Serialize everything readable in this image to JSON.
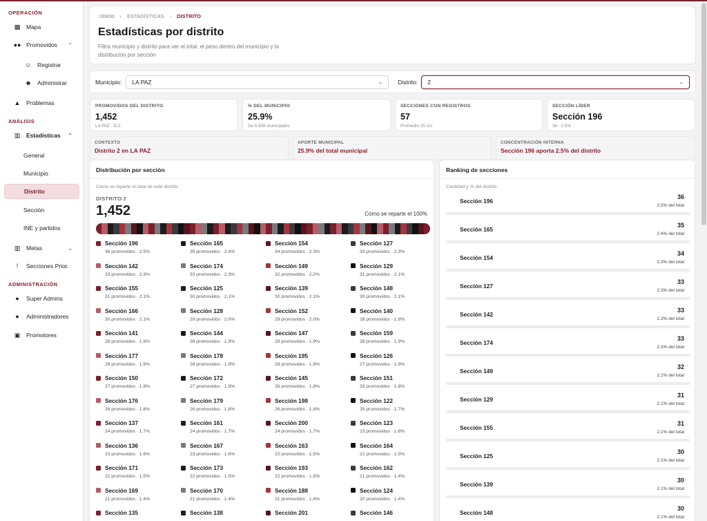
{
  "sidebar": {
    "sections": [
      {
        "title": "OPERACIÓN"
      },
      {
        "title": "ANÁLISIS"
      },
      {
        "title": "ADMINISTRACIÓN"
      }
    ],
    "items": {
      "mapa": {
        "label": "Mapa",
        "icon": "map-icon"
      },
      "promovidos": {
        "label": "Promovidos",
        "icon": "users-icon"
      },
      "registrar": {
        "label": "Registrar",
        "icon": "user-add-icon"
      },
      "administrar": {
        "label": "Administrar",
        "icon": "user-manage-icon"
      },
      "problemas": {
        "label": "Problemas",
        "icon": "warning-icon"
      },
      "estadisticas": {
        "label": "Estadísticas",
        "icon": "bar-chart-icon"
      },
      "general": {
        "label": "General"
      },
      "municipio": {
        "label": "Municipio"
      },
      "distrito": {
        "label": "Distrito"
      },
      "seccion": {
        "label": "Sección"
      },
      "ine": {
        "label": "INE y partidos"
      },
      "metas": {
        "label": "Metas",
        "icon": "bar-chart-icon"
      },
      "secciones_prior": {
        "label": "Secciones Prior.",
        "icon": "exclamation-icon"
      },
      "super_admins": {
        "label": "Super Admins",
        "icon": "user-icon"
      },
      "administradores": {
        "label": "Administradores",
        "icon": "user-icon"
      },
      "promotores": {
        "label": "Promotores",
        "icon": "badge-icon"
      }
    }
  },
  "header": {
    "breadcrumb": [
      "Inicio",
      "ESTADÍSTICAS",
      "DISTRITO"
    ],
    "title": "Estadísticas por distrito",
    "description": "Filtra municipio y distrito para ver el total, el peso dentro del municipio y la distribución por sección"
  },
  "filters": {
    "municipio_label": "Municipio:",
    "municipio_value": "LA PAZ",
    "distrito_label": "Distrito:",
    "distrito_value": "2"
  },
  "kpis": [
    {
      "label": "PROMOVIDOS DEL DISTRITO",
      "value": "1,452",
      "sub": "LA PAZ · D-2"
    },
    {
      "label": "% DEL MUNICIPIO",
      "value": "25.9%",
      "sub": "De 5,606 municipales"
    },
    {
      "label": "SECCIONES CON REGISTROS",
      "value": "57",
      "sub": "Promedio 25 c/u"
    },
    {
      "label": "SECCIÓN LÍDER",
      "value": "Sección 196",
      "sub": "36 · 2.5%"
    }
  ],
  "context": [
    {
      "label": "CONTEXTO",
      "value": "Distrito 2 en LA PAZ"
    },
    {
      "label": "APORTE MUNICIPAL",
      "value": "25.9% del total municipal"
    },
    {
      "label": "CONCENTRACIÓN INTERNA",
      "value": "Sección 196 aporta 2.5% del distrito"
    }
  ],
  "distribution": {
    "title": "Distribución por sección",
    "note": "Cómo se reparte el total de este distrito",
    "district_label": "DISTRITO 2",
    "total": "1,452",
    "right_label": "Cómo se reparte el 100%",
    "colors": [
      "#7a1f2b",
      "#1c1c1e",
      "#5a1420",
      "#3a3a3c",
      "#b75b68",
      "#7a7a7c",
      "#a4343f",
      "#111113"
    ],
    "items": [
      {
        "name": "Sección 196",
        "sub": "36 promovidos · 2.5%"
      },
      {
        "name": "Sección 165",
        "sub": "35 promovidos · 2.4%"
      },
      {
        "name": "Sección 154",
        "sub": "34 promovidos · 2.3%"
      },
      {
        "name": "Sección 127",
        "sub": "33 promovidos · 2.3%"
      },
      {
        "name": "Sección 142",
        "sub": "33 promovidos · 2.3%"
      },
      {
        "name": "Sección 174",
        "sub": "33 promovidos · 2.3%"
      },
      {
        "name": "Sección 149",
        "sub": "32 promovidos · 2.2%"
      },
      {
        "name": "Sección 129",
        "sub": "31 promovidos · 2.1%"
      },
      {
        "name": "Sección 155",
        "sub": "31 promovidos · 2.1%"
      },
      {
        "name": "Sección 125",
        "sub": "30 promovidos · 2.1%"
      },
      {
        "name": "Sección 139",
        "sub": "30 promovidos · 2.1%"
      },
      {
        "name": "Sección 148",
        "sub": "30 promovidos · 2.1%"
      },
      {
        "name": "Sección 166",
        "sub": "30 promovidos · 2.1%"
      },
      {
        "name": "Sección 128",
        "sub": "29 promovidos · 2.0%"
      },
      {
        "name": "Sección 152",
        "sub": "29 promovidos · 2.0%"
      },
      {
        "name": "Sección 140",
        "sub": "28 promovidos · 1.9%"
      },
      {
        "name": "Sección 141",
        "sub": "28 promovidos · 1.9%"
      },
      {
        "name": "Sección 144",
        "sub": "28 promovidos · 1.9%"
      },
      {
        "name": "Sección 147",
        "sub": "28 promovidos · 1.9%"
      },
      {
        "name": "Sección 159",
        "sub": "28 promovidos · 1.9%"
      },
      {
        "name": "Sección 177",
        "sub": "28 promovidos · 1.9%"
      },
      {
        "name": "Sección 178",
        "sub": "28 promovidos · 1.9%"
      },
      {
        "name": "Sección 195",
        "sub": "28 promovidos · 1.9%"
      },
      {
        "name": "Sección 126",
        "sub": "27 promovidos · 1.9%"
      },
      {
        "name": "Sección 150",
        "sub": "27 promovidos · 1.9%"
      },
      {
        "name": "Sección 172",
        "sub": "27 promovidos · 1.9%"
      },
      {
        "name": "Sección 145",
        "sub": "26 promovidos · 1.8%"
      },
      {
        "name": "Sección 151",
        "sub": "26 promovidos · 1.8%"
      },
      {
        "name": "Sección 176",
        "sub": "26 promovidos · 1.8%"
      },
      {
        "name": "Sección 179",
        "sub": "26 promovidos · 1.8%"
      },
      {
        "name": "Sección 198",
        "sub": "26 promovidos · 1.8%"
      },
      {
        "name": "Sección 122",
        "sub": "25 promovidos · 1.7%"
      },
      {
        "name": "Sección 137",
        "sub": "24 promovidos · 1.7%"
      },
      {
        "name": "Sección 161",
        "sub": "24 promovidos · 1.7%"
      },
      {
        "name": "Sección 200",
        "sub": "24 promovidos · 1.7%"
      },
      {
        "name": "Sección 123",
        "sub": "23 promovidos · 1.6%"
      },
      {
        "name": "Sección 136",
        "sub": "23 promovidos · 1.6%"
      },
      {
        "name": "Sección 167",
        "sub": "23 promovidos · 1.6%"
      },
      {
        "name": "Sección 163",
        "sub": "22 promovidos · 1.5%"
      },
      {
        "name": "Sección 164",
        "sub": "22 promovidos · 1.5%"
      },
      {
        "name": "Sección 171",
        "sub": "22 promovidos · 1.5%"
      },
      {
        "name": "Sección 173",
        "sub": "22 promovidos · 1.5%"
      },
      {
        "name": "Sección 193",
        "sub": "22 promovidos · 1.5%"
      },
      {
        "name": "Sección 162",
        "sub": "21 promovidos · 1.4%"
      },
      {
        "name": "Sección 169",
        "sub": "21 promovidos · 1.4%"
      },
      {
        "name": "Sección 170",
        "sub": "21 promovidos · 1.4%"
      },
      {
        "name": "Sección 188",
        "sub": "21 promovidos · 1.4%"
      },
      {
        "name": "Sección 124",
        "sub": "20 promovidos · 1.4%"
      },
      {
        "name": "Sección 135",
        "sub": ""
      },
      {
        "name": "Sección 138",
        "sub": ""
      },
      {
        "name": "Sección 201",
        "sub": ""
      },
      {
        "name": "Sección 146",
        "sub": ""
      }
    ]
  },
  "ranking": {
    "title": "Ranking de secciones",
    "note": "Cantidad y % del distrito",
    "items": [
      {
        "name": "Sección 196",
        "count": "36",
        "pct": "2.5% del total"
      },
      {
        "name": "Sección 165",
        "count": "35",
        "pct": "2.4% del total"
      },
      {
        "name": "Sección 154",
        "count": "34",
        "pct": "2.3% del total"
      },
      {
        "name": "Sección 127",
        "count": "33",
        "pct": "2.3% del total"
      },
      {
        "name": "Sección 142",
        "count": "33",
        "pct": "2.3% del total"
      },
      {
        "name": "Sección 174",
        "count": "33",
        "pct": "2.3% del total"
      },
      {
        "name": "Sección 149",
        "count": "32",
        "pct": "2.2% del total"
      },
      {
        "name": "Sección 129",
        "count": "31",
        "pct": "2.1% del total"
      },
      {
        "name": "Sección 155",
        "count": "31",
        "pct": "2.1% del total"
      },
      {
        "name": "Sección 125",
        "count": "30",
        "pct": "2.1% del total"
      },
      {
        "name": "Sección 139",
        "count": "30",
        "pct": "2.1% del total"
      },
      {
        "name": "Sección 148",
        "count": "30",
        "pct": "2.1% del total"
      }
    ]
  }
}
